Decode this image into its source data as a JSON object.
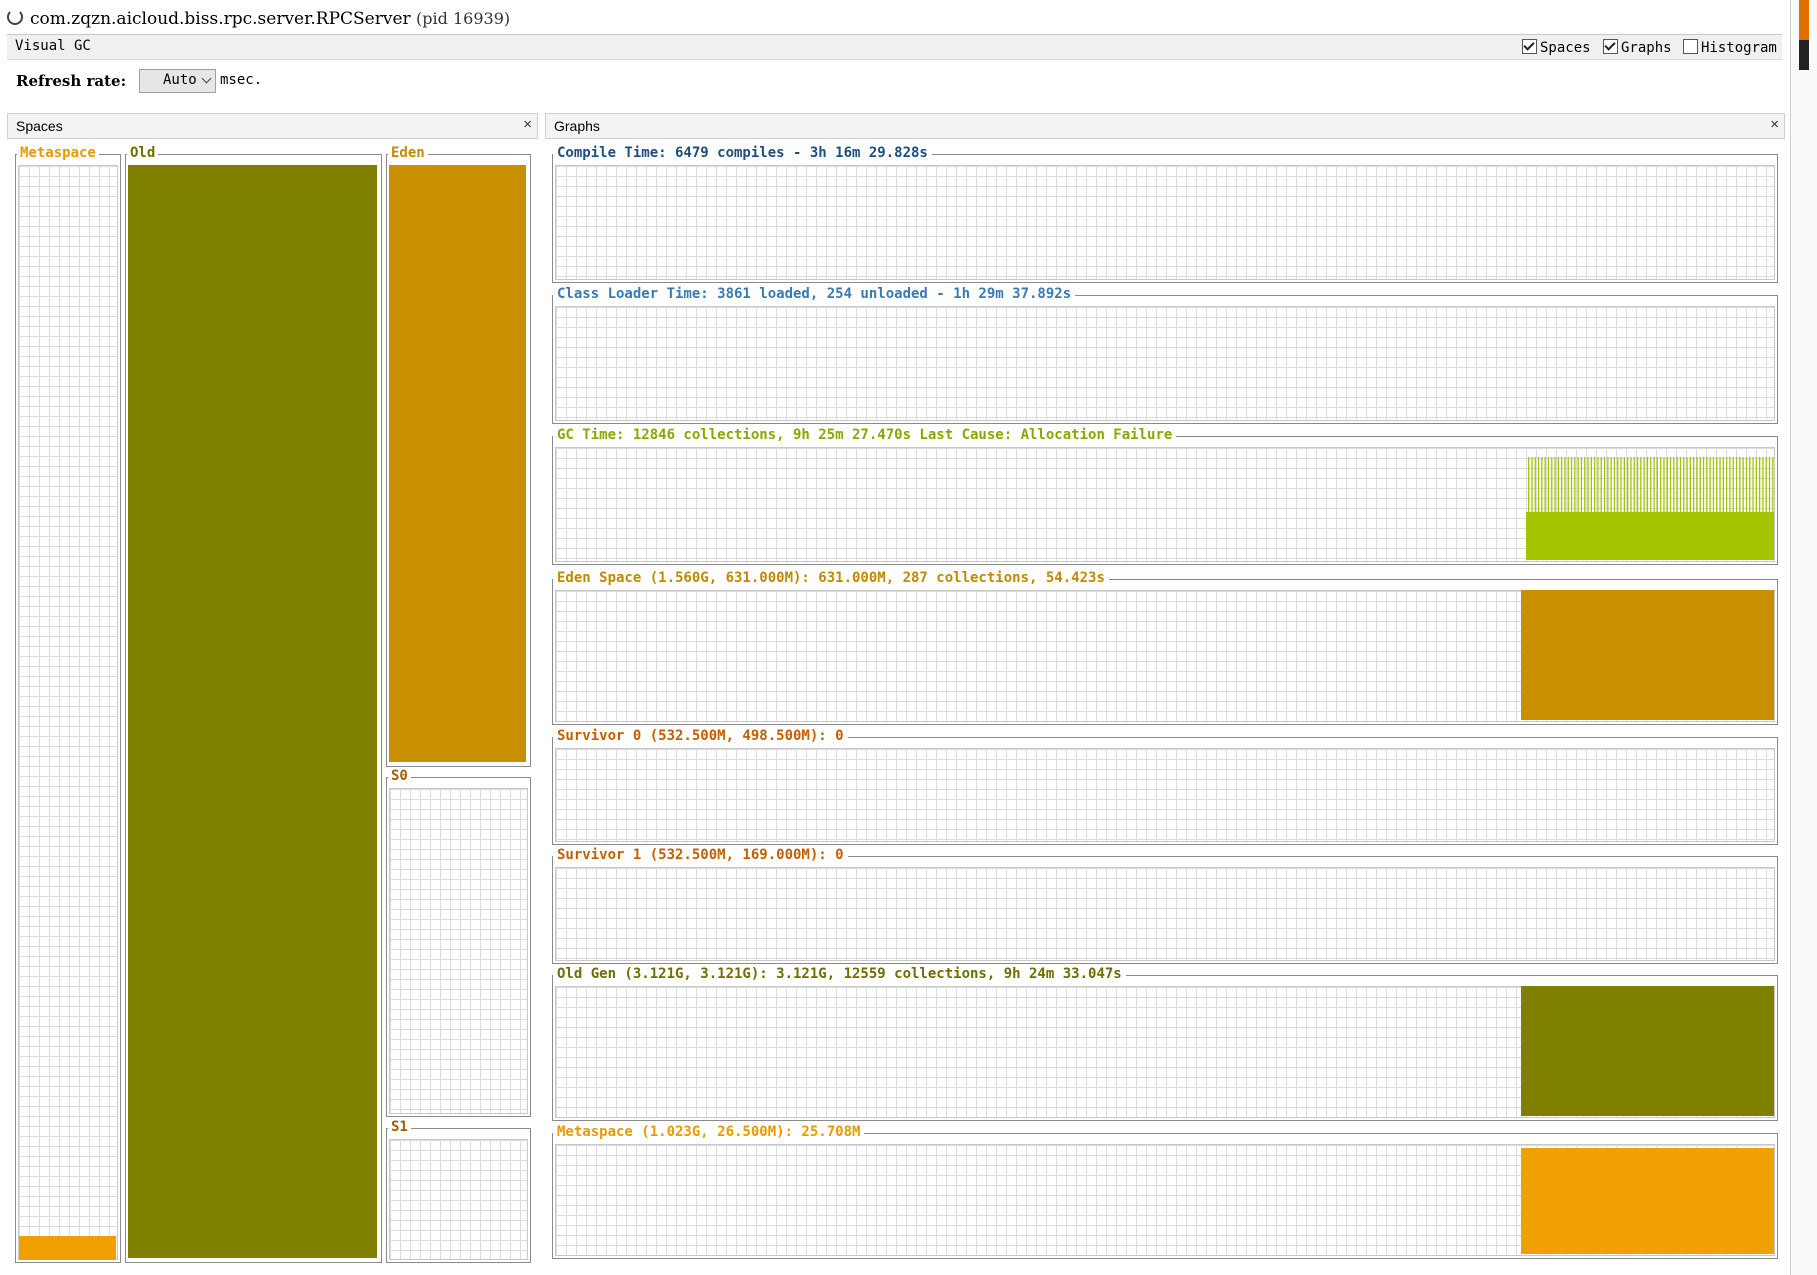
{
  "window": {
    "title": "com.zqzn.aicloud.biss.rpc.server.RPCServer",
    "pid": "(pid 16939)"
  },
  "tab": {
    "label": "Visual GC",
    "options": [
      {
        "label": "Spaces",
        "checked": true
      },
      {
        "label": "Graphs",
        "checked": true
      },
      {
        "label": "Histogram",
        "checked": false
      }
    ]
  },
  "refresh": {
    "label": "Refresh rate:",
    "value": "Auto",
    "unit": "msec."
  },
  "spaces_panel": {
    "title": "Spaces",
    "close": "×",
    "metaspace": {
      "label": "Metaspace",
      "fill_fraction": 0.02,
      "color": "#f0a000"
    },
    "old": {
      "label": "Old",
      "fill_fraction": 1.0,
      "color": "#808000"
    },
    "eden": {
      "label": "Eden",
      "fill_fraction": 1.0,
      "color": "#c89000"
    },
    "s0": {
      "label": "S0",
      "fill_fraction": 0.0
    },
    "s1": {
      "label": "S1",
      "fill_fraction": 0.0
    }
  },
  "graphs_panel": {
    "title": "Graphs",
    "close": "×",
    "graphs": [
      {
        "name": "compile-time",
        "label": "Compile Time: 6479 compiles - 3h 16m 29.828s",
        "color": "#1f4e79"
      },
      {
        "name": "class-loader-time",
        "label": "Class Loader Time: 3861 loaded, 254 unloaded - 1h 29m 37.892s",
        "color": "#3b7ab0"
      },
      {
        "name": "gc-time",
        "label": "GC Time: 12846 collections, 9h 25m 27.470s  Last Cause: Allocation Failure",
        "color": "#88a800"
      },
      {
        "name": "eden-space",
        "label": "Eden Space (1.560G, 631.000M): 631.000M, 287 collections, 54.423s",
        "color": "#c89000"
      },
      {
        "name": "survivor-0",
        "label": "Survivor 0 (532.500M, 498.500M): 0",
        "color": "#c06000"
      },
      {
        "name": "survivor-1",
        "label": "Survivor 1 (532.500M, 169.000M): 0",
        "color": "#c06000"
      },
      {
        "name": "old-gen",
        "label": "Old Gen (3.121G, 3.121G): 3.121G, 12559 collections, 9h 24m 33.047s",
        "color": "#808000"
      },
      {
        "name": "metaspace",
        "label": "Metaspace (1.023G, 26.500M): 25.708M",
        "color": "#f0a000"
      }
    ]
  }
}
